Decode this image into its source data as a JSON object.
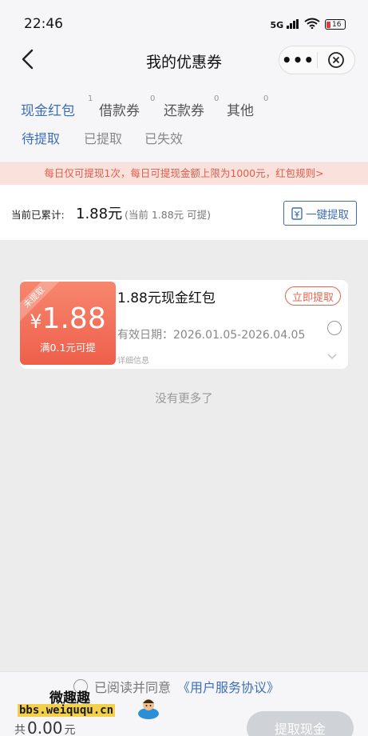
{
  "status_bar": {
    "time": "22:46",
    "network": "5G",
    "battery": "16"
  },
  "nav": {
    "title": "我的优惠券"
  },
  "tabs": [
    {
      "label": "现金红包",
      "count": "1",
      "active": true
    },
    {
      "label": "借款券",
      "count": "0",
      "active": false
    },
    {
      "label": "还款券",
      "count": "0",
      "active": false
    },
    {
      "label": "其他",
      "count": "0",
      "active": false
    }
  ],
  "subtabs": [
    {
      "label": "待提取",
      "active": true
    },
    {
      "label": "已提取",
      "active": false
    },
    {
      "label": "已失效",
      "active": false
    }
  ],
  "notice": "每日仅可提现1次，每日可提现金额上限为1000元，红包规则>",
  "summary": {
    "label": "当前已累计:",
    "amount": "1.88元",
    "note": "(当前 1.88元 可提)",
    "button": "一键提取"
  },
  "coupon": {
    "ribbon": "未提取",
    "currency": "¥",
    "value": "1.88",
    "condition": "满0.1元可提",
    "title": "1.88元现金红包",
    "claim": "立即提取",
    "validity": "有效日期：2026.01.05-2026.04.05",
    "details": "详细信息"
  },
  "no_more": "没有更多了",
  "footer": {
    "agree_text": "已阅读并同意",
    "agreement_link": "《用户服务协议》",
    "total_prefix": "共",
    "total_value": "0.00",
    "total_unit": "元",
    "withdraw": "提取现金"
  },
  "watermark": {
    "title": "微趣趣",
    "url": "bbs.weiququ.cn"
  },
  "colors": {
    "accent": "#3d6fb6",
    "red": "#e4664f",
    "disabled": "#cfd2d6"
  }
}
